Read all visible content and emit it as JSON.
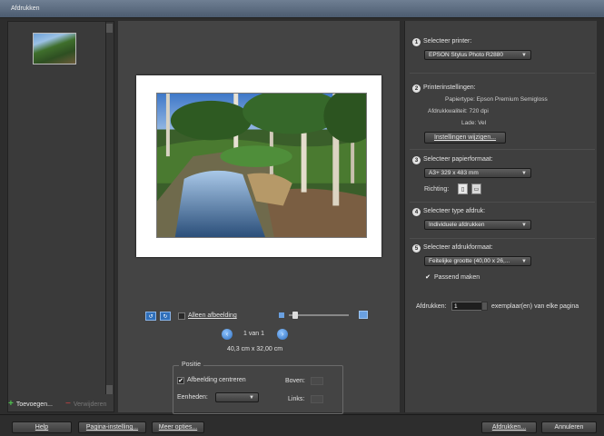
{
  "window": {
    "title": "Afdrukken"
  },
  "left_panel": {
    "add_label": "Toevoegen...",
    "remove_label": "Verwijderen"
  },
  "center": {
    "only_image_label": "Alleen afbeelding",
    "page_indicator": "1 van 1",
    "dimensions": "40,3 cm x 32,00 cm",
    "position": {
      "legend": "Positie",
      "center_image_label": "Afbeelding centreren",
      "center_image_checked": true,
      "units_label": "Eenheden:",
      "units_value": "",
      "top_label": "Boven:",
      "left_label": "Links:"
    }
  },
  "right": {
    "step1": {
      "number": "1",
      "label": "Selecteer printer:",
      "printer": "EPSON Stylus Photo R2880"
    },
    "step2": {
      "number": "2",
      "label": "Printerinstellingen:",
      "paper_type": "Papiertype: Epson Premium Semigloss",
      "print_quality": "Afdrukkwaliteit: 720 dpi",
      "tray": "Lade: Vel",
      "change_button": "Instellingen wijzigen..."
    },
    "step3": {
      "number": "3",
      "label": "Selecteer papierformaat:",
      "paper_size": "A3+ 329 x 483 mm",
      "orientation_label": "Richting:"
    },
    "step4": {
      "number": "4",
      "label": "Selecteer type afdruk:",
      "print_type": "Individuele afdrukken"
    },
    "step5": {
      "number": "5",
      "label": "Selecteer afdrukformaat:",
      "print_size": "Feitelijke grootte (40,00 x 26,...",
      "fit_label": "Passend maken",
      "fit_checked": true
    },
    "copies": {
      "label": "Afdrukken:",
      "value": "1",
      "suffix": "exemplaar(en) van elke pagina"
    }
  },
  "footer": {
    "help": "Help",
    "page_setup": "Pagina-instelling...",
    "more_options": "Meer opties...",
    "print": "Afdrukken...",
    "cancel": "Annuleren"
  }
}
